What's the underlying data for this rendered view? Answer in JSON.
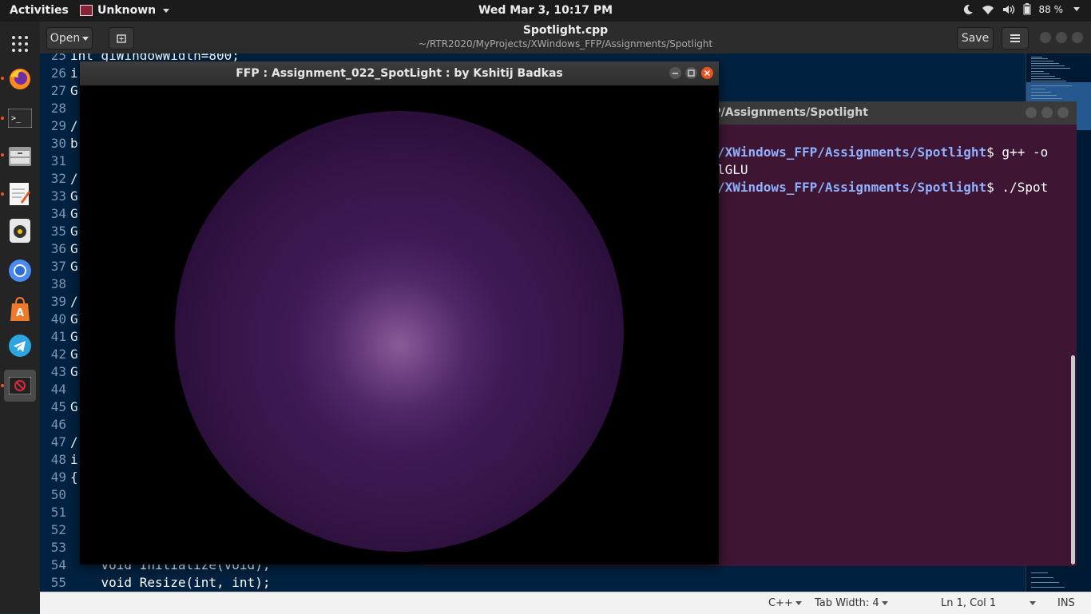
{
  "topbar": {
    "activities": "Activities",
    "app_menu": "Unknown",
    "clock": "Wed Mar  3, 10:17 PM",
    "battery": "88 %"
  },
  "dock": {
    "items": [
      "firefox-icon",
      "terminal-icon",
      "files-icon",
      "text-editor-icon",
      "rhythmbox-icon",
      "chromium-icon",
      "software-center-icon",
      "telegram-icon",
      "opengl-app-icon"
    ]
  },
  "editor": {
    "open_label": "Open",
    "save_label": "Save",
    "title": "Spotlight.cpp",
    "subtitle": "~/RTR2020/MyProjects/XWindows_FFP/Assignments/Spotlight",
    "lines": [
      {
        "n": "25",
        "text": "int giWindowWidth=800;"
      },
      {
        "n": "26",
        "text": "i"
      },
      {
        "n": "27",
        "text": "G"
      },
      {
        "n": "28",
        "text": ""
      },
      {
        "n": "29",
        "text": "/"
      },
      {
        "n": "30",
        "text": "b"
      },
      {
        "n": "31",
        "text": ""
      },
      {
        "n": "32",
        "text": "/"
      },
      {
        "n": "33",
        "text": "G"
      },
      {
        "n": "34",
        "text": "G"
      },
      {
        "n": "35",
        "text": "G"
      },
      {
        "n": "36",
        "text": "G"
      },
      {
        "n": "37",
        "text": "G"
      },
      {
        "n": "38",
        "text": ""
      },
      {
        "n": "39",
        "text": "/"
      },
      {
        "n": "40",
        "text": "G"
      },
      {
        "n": "41",
        "text": "G"
      },
      {
        "n": "42",
        "text": "G"
      },
      {
        "n": "43",
        "text": "G"
      },
      {
        "n": "44",
        "text": ""
      },
      {
        "n": "45",
        "text": "G"
      },
      {
        "n": "46",
        "text": ""
      },
      {
        "n": "47",
        "text": "/"
      },
      {
        "n": "48",
        "text": "i"
      },
      {
        "n": "49",
        "text": "{"
      },
      {
        "n": "50",
        "text": ""
      },
      {
        "n": "51",
        "text": ""
      },
      {
        "n": "52",
        "text": ""
      },
      {
        "n": "53",
        "text": ""
      },
      {
        "n": "54",
        "text": "    void Initialize(void);"
      },
      {
        "n": "55",
        "text": "    void Resize(int, int);"
      }
    ]
  },
  "statusbar": {
    "language": "C++",
    "tab_width": "Tab Width: 4",
    "position": "Ln 1, Col 1",
    "mode": "INS"
  },
  "terminal": {
    "title": "ojects/XWindows_FFP/Assignments/Spotlight",
    "lines": [
      {
        "path": "/XWindows_FFP/Assignments/Spotlight",
        "cmd": "$ g++ -o"
      },
      {
        "path": "",
        "cmd": "lGLU"
      },
      {
        "path": "/XWindows_FFP/Assignments/Spotlight",
        "cmd": "$ ./Spot"
      }
    ]
  },
  "glwindow": {
    "title": "FFP : Assignment_022_SpotLight : by Kshitij Badkas"
  },
  "colors": {
    "editor_bg": "#002240",
    "terminal_bg": "#3e1633",
    "sphere": "#3f1a55",
    "highlight": "#8a5c98",
    "accent": "#e95420"
  }
}
